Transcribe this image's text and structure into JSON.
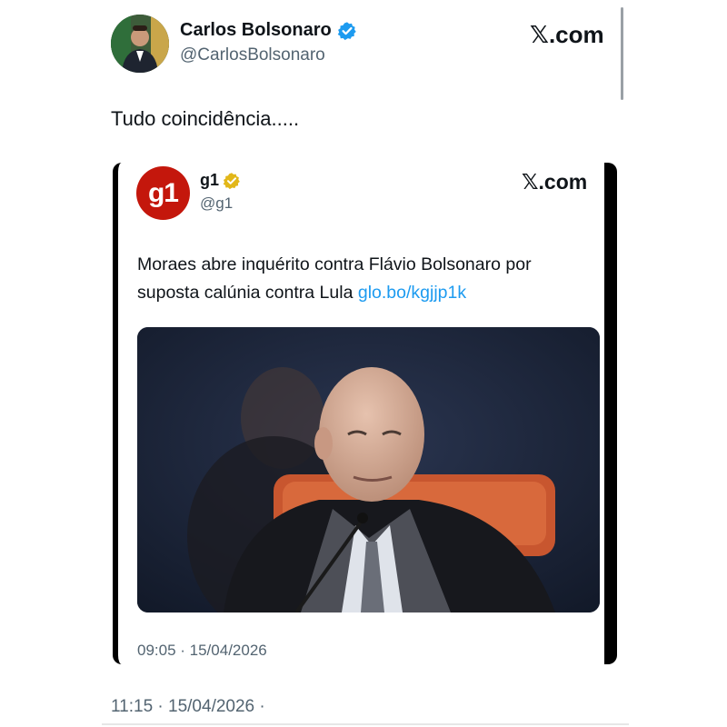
{
  "author": {
    "name": "Carlos Bolsonaro",
    "handle": "@CarlosBolsonaro",
    "verified_icon": "blue-verified-badge"
  },
  "brand": {
    "x_mark": "𝕏",
    "x_suffix": ".com"
  },
  "tweet": {
    "text": "Tudo coincidência.....",
    "timestamp": "11:15 · 15/04/2026 ·"
  },
  "quoted": {
    "logo_text": "g1",
    "name": "g1",
    "handle": "@g1",
    "verified_icon": "gold-verified-badge",
    "text": "Moraes abre inquérito contra Flávio Bolsonaro por suposta calúnia contra Lula",
    "link": "glo.bo/kgjjp1k",
    "timestamp": "09:05 · 15/04/2026"
  },
  "colors": {
    "link": "#1d9bf0",
    "verified_blue": "#1d9bf0",
    "verified_gold": "#e2b719",
    "g1_red": "#c4170c"
  }
}
